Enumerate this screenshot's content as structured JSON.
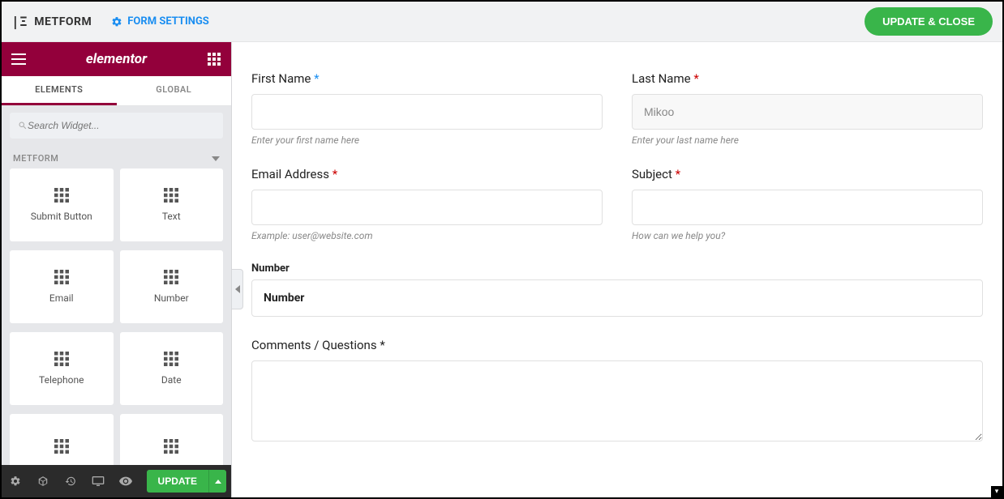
{
  "topbar": {
    "brand": "METFORM",
    "form_settings_label": "FORM SETTINGS",
    "update_close_label": "UPDATE & CLOSE"
  },
  "sidebar": {
    "brand": "elementor",
    "tabs": {
      "elements": "ELEMENTS",
      "global": "GLOBAL"
    },
    "search_placeholder": "Search Widget...",
    "category": "METFORM",
    "widgets": [
      {
        "label": "Submit Button"
      },
      {
        "label": "Text"
      },
      {
        "label": "Email"
      },
      {
        "label": "Number"
      },
      {
        "label": "Telephone"
      },
      {
        "label": "Date"
      },
      {
        "label": ""
      },
      {
        "label": ""
      }
    ],
    "footer": {
      "update_label": "UPDATE"
    }
  },
  "form": {
    "first_name": {
      "label": "First Name",
      "help": "Enter your first name here",
      "value": ""
    },
    "last_name": {
      "label": "Last Name",
      "help": "Enter your last name here",
      "value": "Mikoo"
    },
    "email": {
      "label": "Email Address",
      "help": "Example: user@website.com",
      "value": ""
    },
    "subject": {
      "label": "Subject",
      "help": "How can we help you?",
      "value": ""
    },
    "number": {
      "section_label": "Number",
      "box_label": "Number"
    },
    "comments": {
      "label": "Comments / Questions"
    }
  }
}
